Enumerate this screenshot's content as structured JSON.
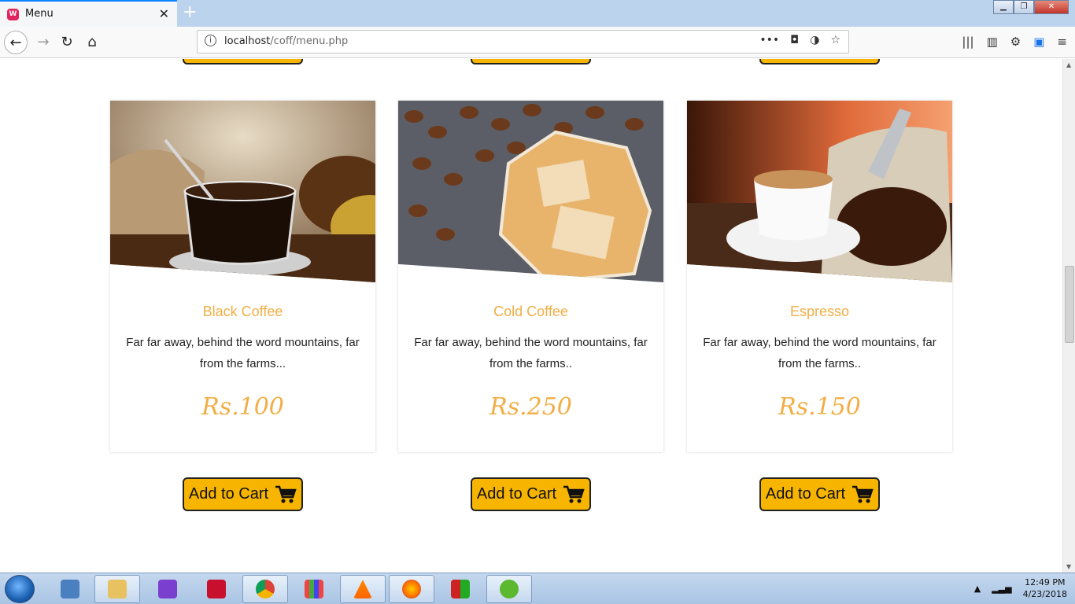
{
  "browser": {
    "tab_title": "Menu",
    "url_host": "localhost",
    "url_path": "/coff/menu.php"
  },
  "menu": {
    "items": [
      {
        "name": "Black Coffee",
        "desc": "Far far away, behind the word mountains, far from the farms...",
        "price": "Rs.100",
        "cart_label": "Add to Cart"
      },
      {
        "name": "Cold Coffee",
        "desc": "Far far away, behind the word mountains, far from the farms..",
        "price": "Rs.250",
        "cart_label": "Add to Cart"
      },
      {
        "name": "Espresso",
        "desc": "Far far away, behind the word mountains, far from the farms..",
        "price": "Rs.150",
        "cart_label": "Add to Cart"
      }
    ]
  },
  "taskbar": {
    "time": "12:49 PM",
    "date": "4/23/2018",
    "apps": [
      "file-explorer-icon",
      "visual-studio-icon",
      "acrobat-icon",
      "chrome-icon",
      "apps-icon",
      "vlc-icon",
      "firefox-icon",
      "winrar-icon",
      "utorrent-icon"
    ]
  },
  "colors": {
    "accent": "#f2ae45",
    "button": "#f7b500"
  }
}
